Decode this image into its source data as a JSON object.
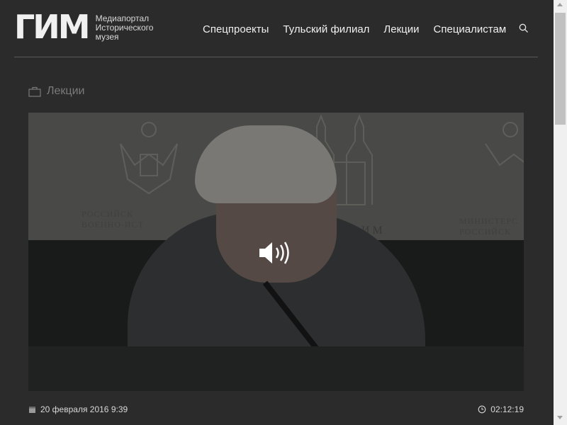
{
  "header": {
    "logo_mark": "ГИМ",
    "logo_lines": [
      "Медиапортал",
      "Исторического",
      "музея"
    ],
    "nav": [
      "Спецпроекты",
      "Тульский филиал",
      "Лекции",
      "Специалистам"
    ]
  },
  "section": {
    "label": "Лекции"
  },
  "video": {
    "wall_text_left_1": "РОССИЙСК",
    "wall_text_left_2": "ВОЕННО-ИСТ",
    "wall_text_right_1": "МИНИСТЕРС",
    "wall_text_right_2": "РОССИЙСК",
    "wall_text_mid": "И М"
  },
  "meta": {
    "date": "20 февраля 2016 9:39",
    "duration": "02:12:19"
  },
  "colors": {
    "background": "#2b2b2b",
    "text": "#e6e6e6",
    "muted": "#7a7a7a"
  }
}
